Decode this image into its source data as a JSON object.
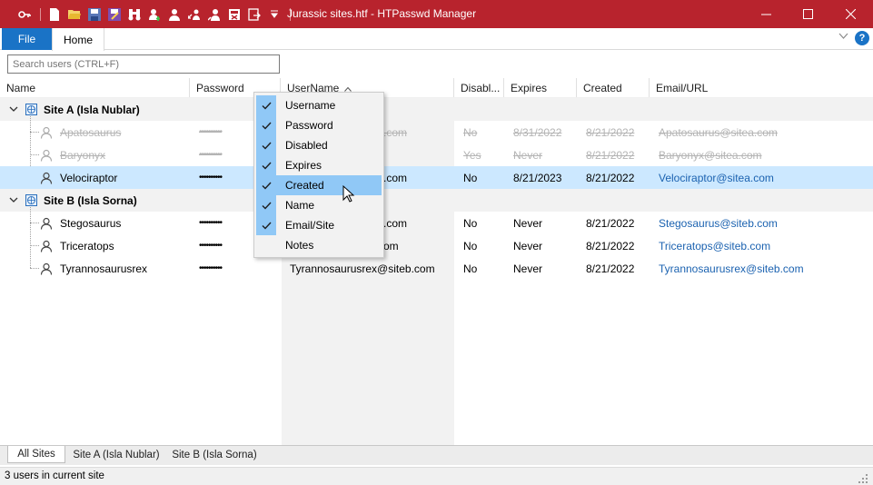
{
  "window": {
    "title": "Jurassic sites.htf - HTPasswd Manager",
    "accent_color": "#b8232d",
    "quick_access_icons": [
      "key-icon",
      "new-file-icon",
      "open-folder-icon",
      "save-icon",
      "save-as-icon",
      "find-users-icon",
      "add-user-icon",
      "user-icon",
      "user-move-icon",
      "edit-user-icon",
      "delete-icon",
      "export-icon",
      "customize-dropdown-icon"
    ]
  },
  "ribbon": {
    "file_tab": "File",
    "home_tab": "Home",
    "help_label": "?"
  },
  "search": {
    "placeholder": "Search users (CTRL+F)"
  },
  "columns": [
    "Name",
    "Password",
    "UserName",
    "Disabl...",
    "Expires",
    "Created",
    "Email/URL"
  ],
  "sort_indicator": "^",
  "groups": [
    {
      "name": "Site A (Isla Nublar)",
      "users": [
        {
          "name": "Apatosaurus",
          "password": "••••••••••",
          "username": "",
          "username_tail": ".com",
          "disabled": "No",
          "expires": "8/31/2022",
          "created": "8/21/2022",
          "email": "Apatosaurus@sitea.com",
          "state": "disabled"
        },
        {
          "name": "Baryonyx",
          "password": "••••••••••",
          "username": "",
          "username_tail": "",
          "disabled": "Yes",
          "expires": "Never",
          "created": "8/21/2022",
          "email": "Baryonyx@sitea.com",
          "state": "disabled"
        },
        {
          "name": "Velociraptor",
          "password": "••••••••••",
          "username": "",
          "username_tail": ".com",
          "disabled": "No",
          "expires": "8/21/2023",
          "created": "8/21/2022",
          "email": "Velociraptor@sitea.com",
          "state": "selected"
        }
      ]
    },
    {
      "name": "Site B (Isla Sorna)",
      "users": [
        {
          "name": "Stegosaurus",
          "password": "••••••••••",
          "username": "",
          "username_tail": ".com",
          "disabled": "No",
          "expires": "Never",
          "created": "8/21/2022",
          "email": "Stegosaurus@siteb.com",
          "state": "normal"
        },
        {
          "name": "Triceratops",
          "password": "••••••••••",
          "username": "",
          "username_tail": "om",
          "disabled": "No",
          "expires": "Never",
          "created": "8/21/2022",
          "email": "Triceratops@siteb.com",
          "state": "normal"
        },
        {
          "name": "Tyrannosaurusrex",
          "password": "••••••••••",
          "username": "Tyrannosaurusrex@siteb.com",
          "username_tail": "",
          "disabled": "No",
          "expires": "Never",
          "created": "8/21/2022",
          "email": "Tyrannosaurusrex@siteb.com",
          "state": "normal"
        }
      ]
    }
  ],
  "column_menu": {
    "items": [
      {
        "label": "Username",
        "checked": true
      },
      {
        "label": "Password",
        "checked": true
      },
      {
        "label": "Disabled",
        "checked": true
      },
      {
        "label": "Expires",
        "checked": true
      },
      {
        "label": "Created",
        "checked": true,
        "hover": true
      },
      {
        "label": "Name",
        "checked": true
      },
      {
        "label": "Email/Site",
        "checked": true
      },
      {
        "label": "Notes",
        "checked": false
      }
    ]
  },
  "bottom_tabs": [
    {
      "label": "All Sites",
      "active": true
    },
    {
      "label": "Site A (Isla Nublar)",
      "active": false
    },
    {
      "label": "Site B (Isla Sorna)",
      "active": false
    }
  ],
  "status": {
    "text": "3 users in current site"
  },
  "colors": {
    "selection": "#cce8ff",
    "menu_check": "#90c8f6",
    "link": "#1b62b0",
    "file_tab": "#1a73c6"
  }
}
